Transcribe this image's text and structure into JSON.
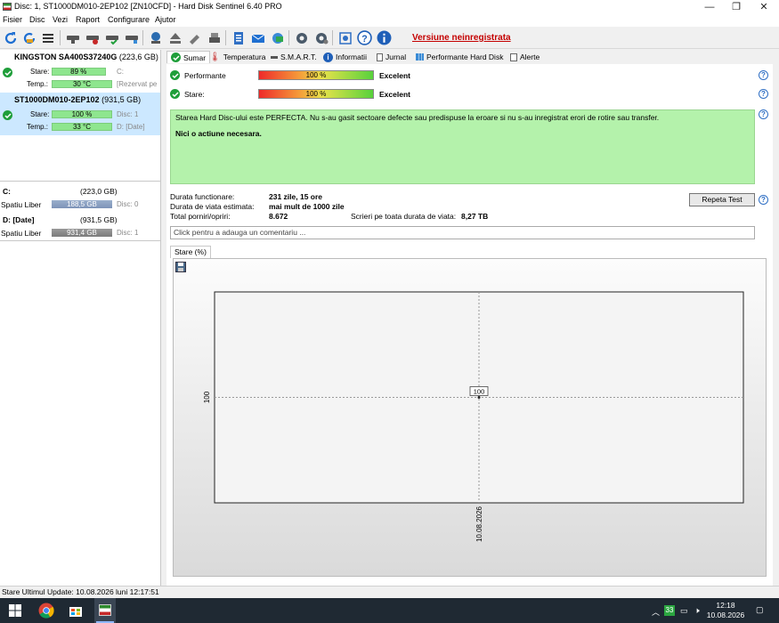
{
  "window": {
    "title": "Disc: 1, ST1000DM010-2EP102 [ZN10CFD] - Hard Disk Sentinel 6.40 PRO",
    "controls": {
      "minimize": "—",
      "maximize": "❐",
      "close": "✕"
    }
  },
  "menu": [
    "Fisier",
    "Disc",
    "Vezi",
    "Raport",
    "Configurare",
    "Ajutor"
  ],
  "toolbar": {
    "icons": [
      "refresh-icon",
      "refresh-disk-icon",
      "disk-list-icon",
      "disk-icon",
      "disk-info-icon",
      "disk-check-icon",
      "disk-gear-icon",
      "network-icon",
      "eject-icon",
      "tools-icon",
      "print-icon",
      "report-icon",
      "email-icon",
      "send-icon",
      "settings-icon",
      "advanced-settings-icon",
      "screenshot-icon",
      "help-icon",
      "info-icon"
    ],
    "unregistered_label": "Versiune neinregistrata"
  },
  "disks": [
    {
      "name": "KINGSTON SA400S37240G",
      "size": "(223,6 GB)",
      "health_label": "Stare:",
      "health": "89 %",
      "health_value": 0.89,
      "temp_label": "Temp.:",
      "temp": "30 °C",
      "drive": "C:",
      "volume": "[Rezervat pe",
      "selected": false
    },
    {
      "name": "ST1000DM010-2EP102",
      "size": "(931,5 GB)",
      "health_label": "Stare:",
      "health": "100 %",
      "health_value": 1.0,
      "temp_label": "Temp.:",
      "temp": "33 °C",
      "drive": "Disc: 1",
      "volume": "D: [Date]",
      "selected": true
    }
  ],
  "volumes": [
    {
      "name": "C:",
      "size": "(223,0 GB)",
      "free_label": "Spatiu Liber",
      "free": "188,5 GB",
      "disk": "Disc: 0"
    },
    {
      "name": "D: [Date]",
      "size": "(931,5 GB)",
      "free_label": "Spatiu Liber",
      "free": "931,4 GB",
      "disk": "Disc: 1"
    }
  ],
  "tabs": [
    "Sumar",
    "Temperatura",
    "S.M.A.R.T.",
    "Informatii",
    "Jurnal",
    "Performante Hard Disk",
    "Alerte"
  ],
  "summary": {
    "performance_label": "Performante",
    "performance": "100 %",
    "performance_value": 1.0,
    "performance_rating": "Excelent",
    "health_label": "Stare:",
    "health": "100 %",
    "health_value": 1.0,
    "health_rating": "Excelent",
    "status_text": "Starea Hard Disc-ului este PERFECTA. Nu s-au gasit sectoare defecte sau predispuse la eroare si nu s-au inregistrat erori de rotire sau transfer.",
    "action_text": "Nici o actiune necesara."
  },
  "stats": {
    "uptime_label": "Durata functionare:",
    "uptime": "231 zile, 15 ore",
    "lifetime_label": "Durata de viata estimata:",
    "lifetime": "mai mult de 1000 zile",
    "starts_label": "Total porniri/opriri:",
    "starts": "8.672",
    "writes_label": "Scrieri pe toata durata de viata:",
    "writes": "8,27 TB"
  },
  "buttons": {
    "repeat_test": "Repeta Test"
  },
  "comment": {
    "placeholder": "Click pentru a adauga un comentariu ..."
  },
  "chart_tab": "Stare (%)",
  "chart_data": {
    "type": "line",
    "x": [
      "10.08.2026"
    ],
    "series": [
      {
        "values": [
          100
        ]
      }
    ],
    "yticks": [
      "100"
    ],
    "xticks": [
      "10.08.2026"
    ],
    "data_labels": [
      "100"
    ],
    "grid": true
  },
  "statusbar": {
    "text": "Stare Ultimul Update: 10.08.2026 luni 12:17:51"
  },
  "taskbar": {
    "time": "12:18",
    "date": "10.08.2026",
    "tray_badge": "33"
  }
}
